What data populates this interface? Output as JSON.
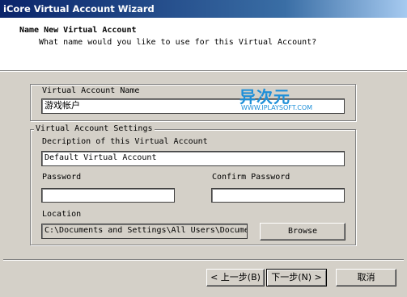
{
  "window": {
    "title": "iCore Virtual Account Wizard"
  },
  "header": {
    "title": "Name New Virtual Account",
    "subtitle": "What name would you like to use for this Virtual Account?"
  },
  "name_group": {
    "label": "Virtual Account Name",
    "value": "游戏帐户"
  },
  "watermark": {
    "main": "异次元",
    "sub": "WWW.IPLAYSOFT.COM"
  },
  "settings_group": {
    "legend": "Virtual Account Settings",
    "description_label": "Decription of this Virtual Account",
    "description_value": "Default Virtual Account",
    "password_label": "Password",
    "password_value": "",
    "confirm_label": "Confirm Password",
    "confirm_value": "",
    "location_label": "Location",
    "location_value": "C:\\Documents and Settings\\All Users\\Documents",
    "browse_label": "Browse"
  },
  "footer": {
    "back_label": "< 上一步(B)",
    "next_label": "下一步(N) >",
    "cancel_label": "取消"
  }
}
